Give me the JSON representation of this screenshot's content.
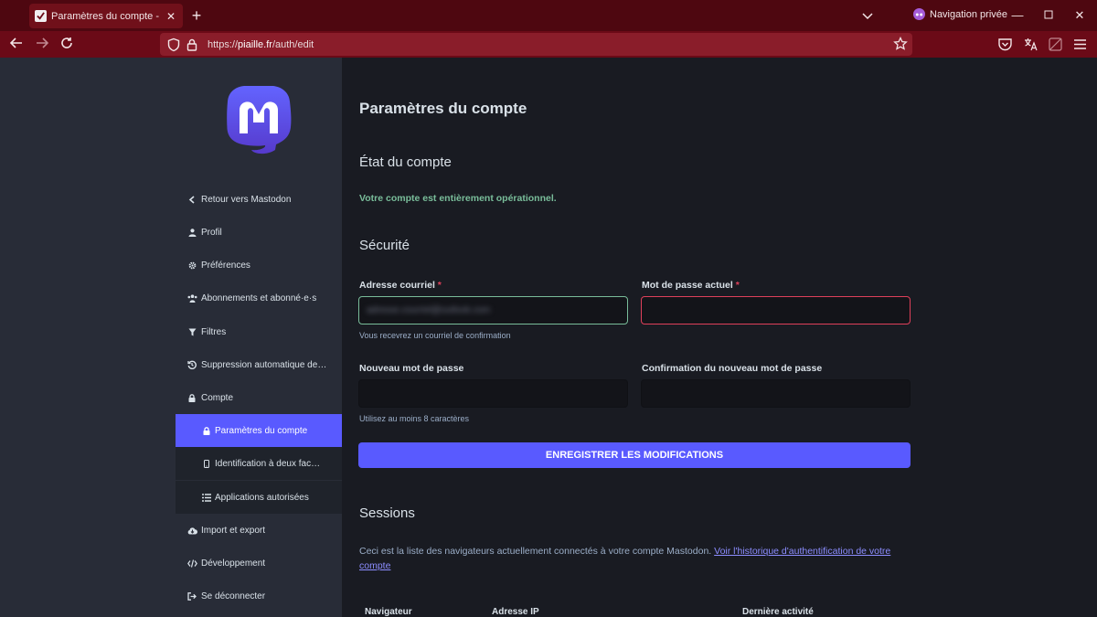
{
  "browser": {
    "tab_title": "Paramètres du compte - Piaille",
    "private_label": "Navigation privée",
    "url_prefix": "https://",
    "url_domain": "piaille.fr",
    "url_path": "/auth/edit"
  },
  "sidebar": {
    "items": [
      {
        "label": "Retour vers Mastodon",
        "icon": "chevron-left-icon"
      },
      {
        "label": "Profil",
        "icon": "user-icon"
      },
      {
        "label": "Préférences",
        "icon": "gear-icon"
      },
      {
        "label": "Abonnements et abonné·e·s",
        "icon": "users-icon"
      },
      {
        "label": "Filtres",
        "icon": "filter-icon"
      },
      {
        "label": "Suppression automatique de …",
        "icon": "history-icon"
      },
      {
        "label": "Compte",
        "icon": "lock-icon"
      },
      {
        "label": "Paramètres du compte",
        "icon": "lock-icon"
      },
      {
        "label": "Identification à deux fac…",
        "icon": "mobile-icon"
      },
      {
        "label": "Applications autorisées",
        "icon": "list-icon"
      },
      {
        "label": "Import et export",
        "icon": "cloud-download-icon"
      },
      {
        "label": "Développement",
        "icon": "code-icon"
      },
      {
        "label": "Se déconnecter",
        "icon": "sign-out-icon"
      }
    ]
  },
  "main": {
    "title": "Paramètres du compte",
    "status_heading": "État du compte",
    "status_text": "Votre compte est entièrement opérationnel.",
    "security_heading": "Sécurité",
    "email_label": "Adresse courriel",
    "email_value": "adresse.courriel@outlook.com",
    "email_hint": "Vous recevrez un courriel de confirmation",
    "current_password_label": "Mot de passe actuel",
    "required_mark": "*",
    "new_password_label": "Nouveau mot de passe",
    "new_password_hint": "Utilisez au moins 8 caractères",
    "confirm_password_label": "Confirmation du nouveau mot de passe",
    "save_button": "ENREGISTRER LES MODIFICATIONS",
    "sessions_heading": "Sessions",
    "sessions_text": "Ceci est la liste des navigateurs actuellement connectés à votre compte Mastodon.",
    "sessions_link": "Voir l'historique d'authentification de votre compte",
    "table_headers": [
      "Navigateur",
      "Adresse IP",
      "Dernière activité"
    ]
  },
  "colors": {
    "accent": "#595aff",
    "success": "#79bd9a",
    "error": "#df405a",
    "browser_frame": "#6b0a17"
  }
}
